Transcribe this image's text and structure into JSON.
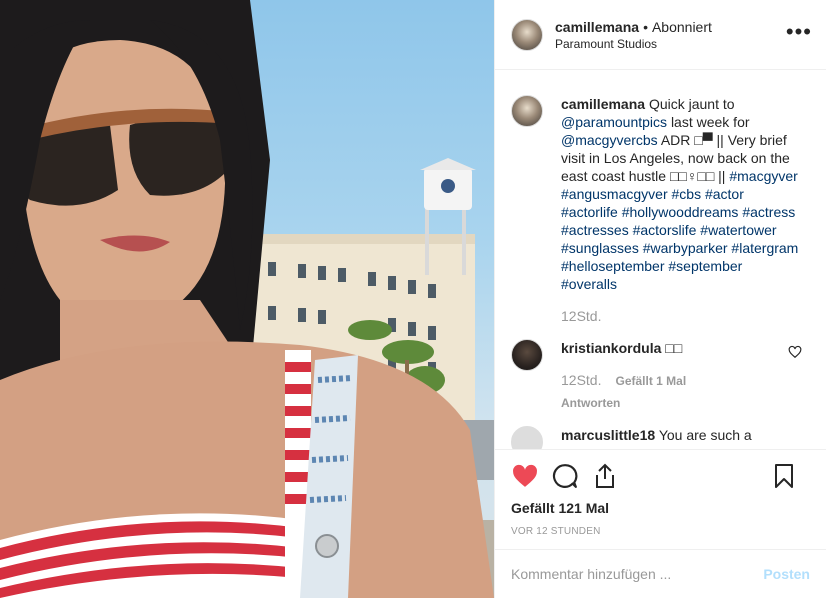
{
  "post": {
    "username": "camillemana",
    "separator": "•",
    "follow_status": "Abonniert",
    "location": "Paramount Studios",
    "more_label": "•••"
  },
  "caption": {
    "username": "camillemana",
    "text_1": "Quick jaunt to",
    "mention_1": "@paramountpics",
    "text_2": "last week for",
    "mention_2": "@macgyvercbs",
    "text_3": "ADR □▀ || Very brief visit in Los Angeles, now back on the east coast hustle □□♀□□ ||",
    "hashtags": "#macgyver #angusmacgyver #cbs #actor #actorlife #hollywooddreams #actress #actresses #actorslife #watertower #sunglasses #warbyparker #latergram #helloseptember #september #overalls",
    "time": "12Std."
  },
  "comments": [
    {
      "username": "kristiankordula",
      "text": "□□",
      "time": "12Std.",
      "likes": "Gefällt 1 Mal",
      "reply_label": "Antworten"
    },
    {
      "username": "marcuslittle18",
      "text": "You are such a"
    }
  ],
  "actions": {
    "likes_text": "Gefällt 121 Mal",
    "posted_ago": "VOR 12 STUNDEN"
  },
  "add_comment": {
    "placeholder": "Kommentar hinzufügen ...",
    "post_label": "Posten"
  },
  "colors": {
    "like_red": "#ed4956",
    "link_blue": "#003569",
    "muted_gray": "#999999",
    "post_disabled": "#b2dffc"
  }
}
